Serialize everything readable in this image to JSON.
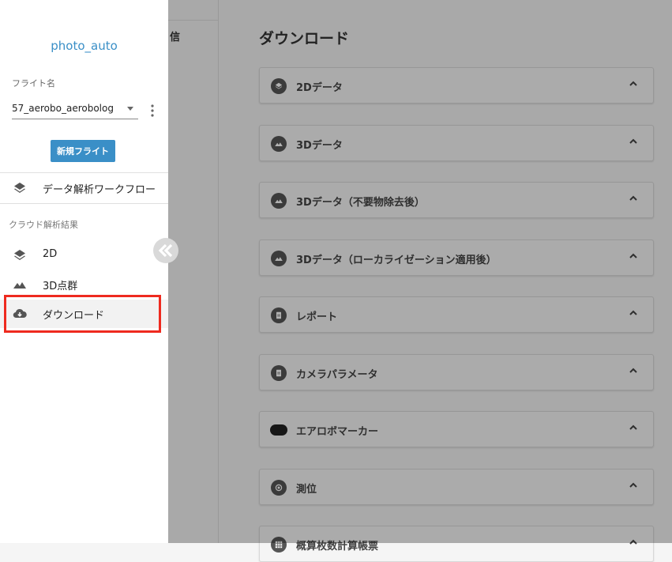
{
  "drawer": {
    "project_name": "photo_auto",
    "flight_label": "フライト名",
    "flight_value": "57_aerobo_aerobolog",
    "new_flight_button": "新規フライト",
    "workflow_item": "データ解析ワークフロー",
    "cloud_section_label": "クラウド解析結果",
    "nav_items": [
      {
        "label": "2D",
        "icon": "layers-icon"
      },
      {
        "label": "3D点群",
        "icon": "terrain-icon"
      },
      {
        "label": "ダウンロード",
        "icon": "cloud-download-icon"
      }
    ],
    "highlight_color": "#ee2a1f"
  },
  "background": {
    "cut_text": "信",
    "title": "ダウンロード",
    "panels": [
      {
        "label": "2Dデータ",
        "icon": "layers-icon"
      },
      {
        "label": "3Dデータ",
        "icon": "terrain-icon"
      },
      {
        "label": "3Dデータ（不要物除去後）",
        "icon": "terrain-icon"
      },
      {
        "label": "3Dデータ（ローカライゼーション適用後）",
        "icon": "terrain-icon"
      },
      {
        "label": "レポート",
        "icon": "document-icon"
      },
      {
        "label": "カメラパラメータ",
        "icon": "document-icon"
      },
      {
        "label": "エアロボマーカー",
        "icon": "marker-icon"
      },
      {
        "label": "測位",
        "icon": "gps-icon"
      },
      {
        "label": "概算枚数計算帳票",
        "icon": "grid-icon"
      }
    ]
  },
  "colors": {
    "accent": "#3a8fc7"
  }
}
